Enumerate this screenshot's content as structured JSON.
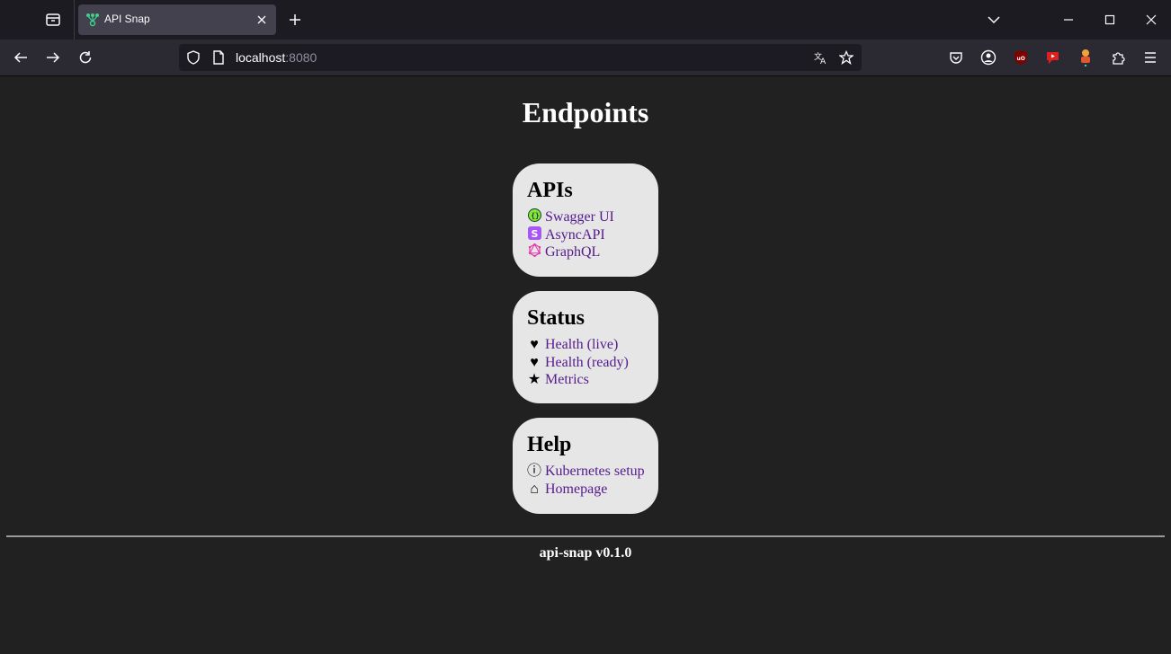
{
  "browser": {
    "tab_title": "API Snap",
    "url_host": "localhost",
    "url_port": ":8080"
  },
  "page": {
    "title": "Endpoints",
    "sections": [
      {
        "heading": "APIs",
        "links": [
          {
            "label": "Swagger UI",
            "icon": "swagger-icon"
          },
          {
            "label": "AsyncAPI",
            "icon": "asyncapi-icon"
          },
          {
            "label": "GraphQL",
            "icon": "graphql-icon"
          }
        ]
      },
      {
        "heading": "Status",
        "links": [
          {
            "label": "Health (live)",
            "icon": "heart-icon",
            "glyph": "♥"
          },
          {
            "label": "Health (ready)",
            "icon": "heart-icon",
            "glyph": "♥"
          },
          {
            "label": "Metrics",
            "icon": "star-icon",
            "glyph": "★"
          }
        ]
      },
      {
        "heading": "Help",
        "links": [
          {
            "label": "Kubernetes setup",
            "icon": "info-icon",
            "glyph": "ⓘ"
          },
          {
            "label": "Homepage",
            "icon": "home-icon",
            "glyph": "⌂"
          }
        ]
      }
    ],
    "footer": "api-snap v0.1.0"
  },
  "colors": {
    "page_bg": "#212121",
    "card_bg": "#e6e6e6",
    "link": "#551a8b"
  }
}
